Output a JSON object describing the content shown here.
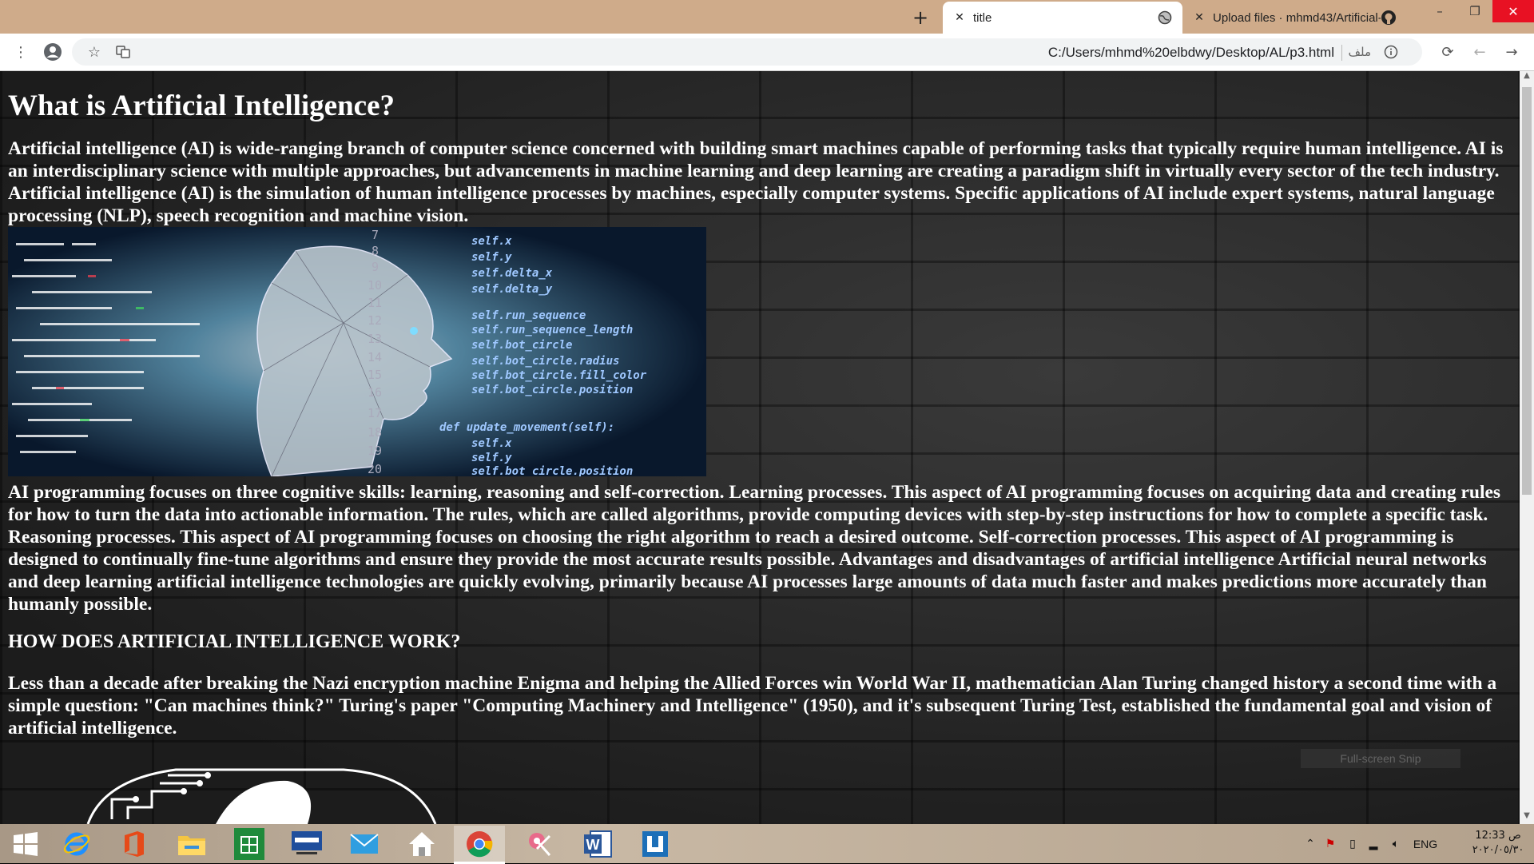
{
  "browser": {
    "tabs": [
      {
        "title": "title",
        "active": true
      },
      {
        "title": "Upload files · mhmd43/Artificial-",
        "active": false
      }
    ],
    "url": "C:/Users/mhmd%20elbdwy/Desktop/AL/p3.html",
    "file_label": "ملف"
  },
  "page": {
    "heading": "What is Artificial Intelligence?",
    "para1": "Artificial intelligence (AI) is wide-ranging branch of computer science concerned with building smart machines capable of performing tasks that typically require human intelligence. AI is an interdisciplinary science with multiple approaches, but advancements in machine learning and deep learning are creating a paradigm shift in virtually every sector of the tech industry. Artificial intelligence (AI) is the simulation of human intelligence processes by machines, especially computer systems. Specific applications of AI include expert systems, natural language processing (NLP), speech recognition and machine vision.",
    "hero_code": [
      "self.x",
      "self.y",
      "self.delta_x",
      "self.delta_y",
      "self.run_sequence",
      "self.run_sequence_length",
      "self.bot_circle",
      "self.bot_circle.radius",
      "self.bot_circle.fill_color",
      "self.bot_circle.position",
      "def update_movement(self):",
      "self.x",
      "self.y",
      "self.bot_circle.position"
    ],
    "hero_line_numbers": [
      "7",
      "8",
      "9",
      "10",
      "11",
      "12",
      "13",
      "14",
      "15",
      "16",
      "17",
      "18",
      "19",
      "20"
    ],
    "para2": "AI programming focuses on three cognitive skills: learning, reasoning and self-correction. Learning processes. This aspect of AI programming focuses on acquiring data and creating rules for how to turn the data into actionable information. The rules, which are called algorithms, provide computing devices with step-by-step instructions for how to complete a specific task. Reasoning processes. This aspect of AI programming focuses on choosing the right algorithm to reach a desired outcome. Self-correction processes. This aspect of AI programming is designed to continually fine-tune algorithms and ensure they provide the most accurate results possible. Advantages and disadvantages of artificial intelligence Artificial neural networks and deep learning artificial intelligence technologies are quickly evolving, primarily because AI processes large amounts of data much faster and makes predictions more accurately than humanly possible.",
    "subheading": "HOW DOES ARTIFICIAL INTELLIGENCE WORK?",
    "para3": "Less than a decade after breaking the Nazi encryption machine Enigma and helping the Allied Forces win World War II, mathematician Alan Turing changed history a second time with a simple question: \"Can machines think?\" Turing's paper \"Computing Machinery and Intelligence\" (1950), and it's subsequent Turing Test, established the fundamental goal and vision of artificial intelligence.",
    "fullscreen_tip": "Full-screen Snip"
  },
  "taskbar": {
    "apps": [
      "start-icon",
      "internet-explorer-icon",
      "office-icon",
      "file-explorer-icon",
      "store-icon",
      "lenovo-icon",
      "mail-icon",
      "home-icon",
      "chrome-icon",
      "snipping-tool-icon",
      "word-icon",
      "app-icon"
    ],
    "lang": "ENG",
    "time": "12:33 ص",
    "date": "٢٠٢٠/٠٥/٣٠"
  },
  "colors": {
    "tabstrip": "#cfab8a",
    "page_text": "#ffffff",
    "close_button": "#e81123"
  }
}
